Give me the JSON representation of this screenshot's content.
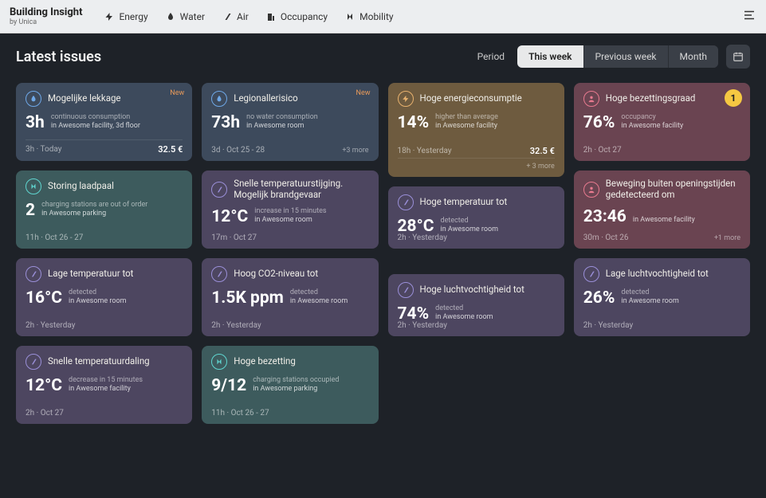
{
  "brand": {
    "title": "Building Insight",
    "sub": "by Unica"
  },
  "nav": {
    "energy": "Energy",
    "water": "Water",
    "air": "Air",
    "occupancy": "Occupancy",
    "mobility": "Mobility"
  },
  "page_title": "Latest issues",
  "period": {
    "label": "Period",
    "this_week": "This week",
    "previous_week": "Previous week",
    "month": "Month"
  },
  "badges": {
    "new": "New",
    "one": "1"
  },
  "cards": {
    "c1": {
      "title": "Mogelijke lekkage",
      "metric": "3h",
      "desc": "continuous consumption",
      "loc": "in Awesome facility, 3d floor",
      "footer_left": "3h · Today",
      "price": "32.5 €"
    },
    "c2": {
      "title": "Legionallerisico",
      "metric": "73h",
      "desc": "no water consumption",
      "loc": "in Awesome room",
      "footer_left": "3d · Oct 25 - 28",
      "extra": "+3 more"
    },
    "c3": {
      "title": "Hoge energieconsumptie",
      "metric": "14%",
      "desc": "higher than average",
      "loc": "in Awesome facility",
      "footer_left": "18h · Yesterday",
      "price": "32.5 €",
      "extra": "+ 3 more"
    },
    "c4": {
      "title": "Hoge bezettingsgraad",
      "metric": "76%",
      "desc": "occupancy",
      "loc": "in Awesome facility",
      "footer_left": "2h · Oct 27"
    },
    "c5": {
      "title": "Storing laadpaal",
      "metric": "2",
      "desc": "charging stations are out of order",
      "loc": "in Awesome parking",
      "footer_left": "11h · Oct 26 - 27"
    },
    "c6": {
      "title": "Snelle temperatuurstijging. Mogelijk brandgevaar",
      "metric": "12°C",
      "desc": "increase in 15 minutes",
      "loc": "in Awesome room",
      "footer_left": "17m · Oct 27"
    },
    "c7": {
      "title": "Hoge temperatuur tot",
      "metric": "28°C",
      "desc": "detected",
      "loc": "in Awesome room",
      "footer_left": "2h · Yesterday"
    },
    "c8": {
      "title": "Beweging buiten openingstijden gedetecteerd om",
      "metric": "23:46",
      "desc": "",
      "loc": "in Awesome facility",
      "footer_left": "30m · Oct 26",
      "extra": "+1 more"
    },
    "c9": {
      "title": "Lage temperatuur tot",
      "metric": "16°C",
      "desc": "detected",
      "loc": "in Awesome room",
      "footer_left": "2h · Yesterday"
    },
    "c10": {
      "title": "Hoog CO2-niveau tot",
      "metric": "1.5K ppm",
      "desc": "detected",
      "loc": "in Awesome room",
      "footer_left": "2h · Yesterday"
    },
    "c11": {
      "title": "Hoge luchtvochtigheid tot",
      "metric": "74%",
      "desc": "detected",
      "loc": "in Awesome room",
      "footer_left": "2h · Yesterday"
    },
    "c12": {
      "title": "Lage luchtvochtigheid tot",
      "metric": "26%",
      "desc": "detected",
      "loc": "in Awesome room",
      "footer_left": "2h · Yesterday"
    },
    "c13": {
      "title": "Snelle temperatuurdaling",
      "metric": "12°C",
      "desc": "decrease in 15 minutes",
      "loc": "in Awesome facility",
      "footer_left": "2h · Oct 27"
    },
    "c14": {
      "title": "Hoge bezetting",
      "metric": "9/12",
      "desc": "charging stations occupied",
      "loc": "in Awesome parking",
      "footer_left": "11h · Oct 26 - 27"
    }
  }
}
